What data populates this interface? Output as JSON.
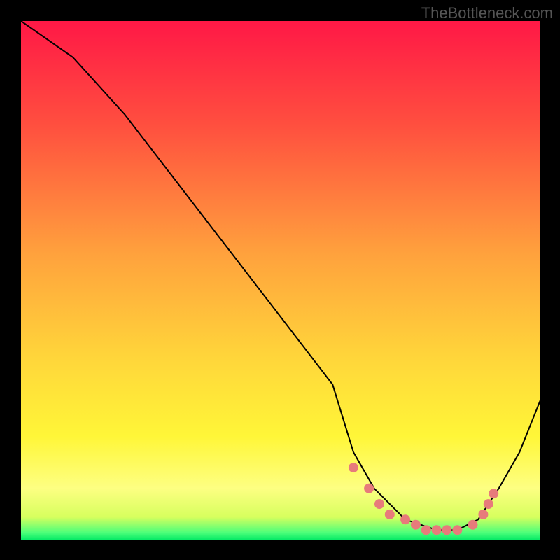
{
  "watermark": "TheBottleneck.com",
  "chart_data": {
    "type": "line",
    "title": "",
    "xlabel": "",
    "ylabel": "",
    "xlim": [
      0,
      100
    ],
    "ylim": [
      0,
      100
    ],
    "series": [
      {
        "name": "curve",
        "x": [
          0,
          10,
          20,
          30,
          40,
          50,
          60,
          64,
          68,
          74,
          80,
          84,
          88,
          92,
          96,
          100
        ],
        "y": [
          100,
          93,
          82,
          69,
          56,
          43,
          30,
          17,
          10,
          4,
          2,
          2,
          4,
          10,
          17,
          27
        ],
        "stroke": "#000000",
        "stroke_width": 2
      }
    ],
    "highlight_points": {
      "color": "#e77b7b",
      "radius": 7,
      "x": [
        64,
        67,
        69,
        71,
        74,
        76,
        78,
        80,
        82,
        84,
        87,
        89,
        90,
        91
      ],
      "y": [
        14,
        10,
        7,
        5,
        4,
        3,
        2,
        2,
        2,
        2,
        3,
        5,
        7,
        9
      ]
    },
    "gradient_stops": [
      {
        "offset": 0.0,
        "color": "#ff1846"
      },
      {
        "offset": 0.2,
        "color": "#ff4f3f"
      },
      {
        "offset": 0.45,
        "color": "#ffa23d"
      },
      {
        "offset": 0.65,
        "color": "#ffd63a"
      },
      {
        "offset": 0.8,
        "color": "#fff638"
      },
      {
        "offset": 0.9,
        "color": "#fdff82"
      },
      {
        "offset": 0.955,
        "color": "#d7ff5e"
      },
      {
        "offset": 0.985,
        "color": "#4dff7a"
      },
      {
        "offset": 1.0,
        "color": "#00e864"
      }
    ]
  }
}
